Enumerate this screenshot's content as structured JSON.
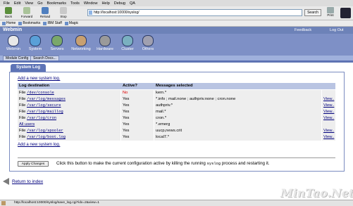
{
  "browser": {
    "menu": [
      "File",
      "Edit",
      "View",
      "Go",
      "Bookmarks",
      "Tools",
      "Window",
      "Help",
      "Debug",
      "QA"
    ],
    "toolbar": {
      "back": "Back",
      "forward": "Forward",
      "reload": "Reload",
      "stop": "Stop",
      "print": "Print"
    },
    "url": "http://localhost:10000/syslog/",
    "search_label": "Search",
    "bookmarks": [
      "Home",
      "Bookmarks",
      "IBM Staff",
      "Magic"
    ],
    "status_text": "http://localhost:10000/syslog/save_log.cgi?idx=2&view=1"
  },
  "webmin": {
    "title": "Webmin",
    "feedback": "Feedback",
    "logout": "Log Out",
    "categories": [
      {
        "label": "Webmin",
        "color": "#e8e8e8"
      },
      {
        "label": "System",
        "color": "#5aa0d8"
      },
      {
        "label": "Servers",
        "color": "#7aa86a"
      },
      {
        "label": "Networking",
        "color": "#c8a070"
      },
      {
        "label": "Hardware",
        "color": "#9a9a9a"
      },
      {
        "label": "Cluster",
        "color": "#7ab0c0"
      },
      {
        "label": "Others",
        "color": "#a0a0b0"
      }
    ],
    "tabs": [
      "Module Config",
      "Search Docs..."
    ]
  },
  "panel": {
    "title": "System Log",
    "add_link": "Add a new system log.",
    "add_link_bottom": "Add a new system log.",
    "headers": [
      "Log destination",
      "Active?",
      "Messages selected",
      ""
    ],
    "rows": [
      {
        "prefix": "File",
        "path": "/dev/console",
        "active": "No",
        "messages": "kern.*",
        "view": ""
      },
      {
        "prefix": "File",
        "path": "/var/log/messages",
        "active": "Yes",
        "messages": "*.info ; mail.none ; authpriv.none ; cron.none",
        "view": "View.."
      },
      {
        "prefix": "File",
        "path": "/var/log/secure",
        "active": "Yes",
        "messages": "authpriv.*",
        "view": "View.."
      },
      {
        "prefix": "File",
        "path": "/var/log/maillog",
        "active": "Yes",
        "messages": "mail.*",
        "view": "View.."
      },
      {
        "prefix": "File",
        "path": "/var/log/cron",
        "active": "Yes",
        "messages": "cron.*",
        "view": "View.."
      },
      {
        "prefix": "All users",
        "path": "",
        "active": "Yes",
        "messages": "*.emerg",
        "view": ""
      },
      {
        "prefix": "File",
        "path": "/var/log/spooler",
        "active": "Yes",
        "messages": "uucp,news.crit",
        "view": "View.."
      },
      {
        "prefix": "File",
        "path": "/var/log/boot.log",
        "active": "Yes",
        "messages": "local7.*",
        "view": "View.."
      }
    ],
    "apply_button": "Apply Changes",
    "apply_text_before": "Click this button to make the current configuration active by killing the running",
    "apply_text_code": "syslog",
    "apply_text_after": "process and restarting it."
  },
  "return_link": "Return to index",
  "watermark": "MinTao.Net"
}
